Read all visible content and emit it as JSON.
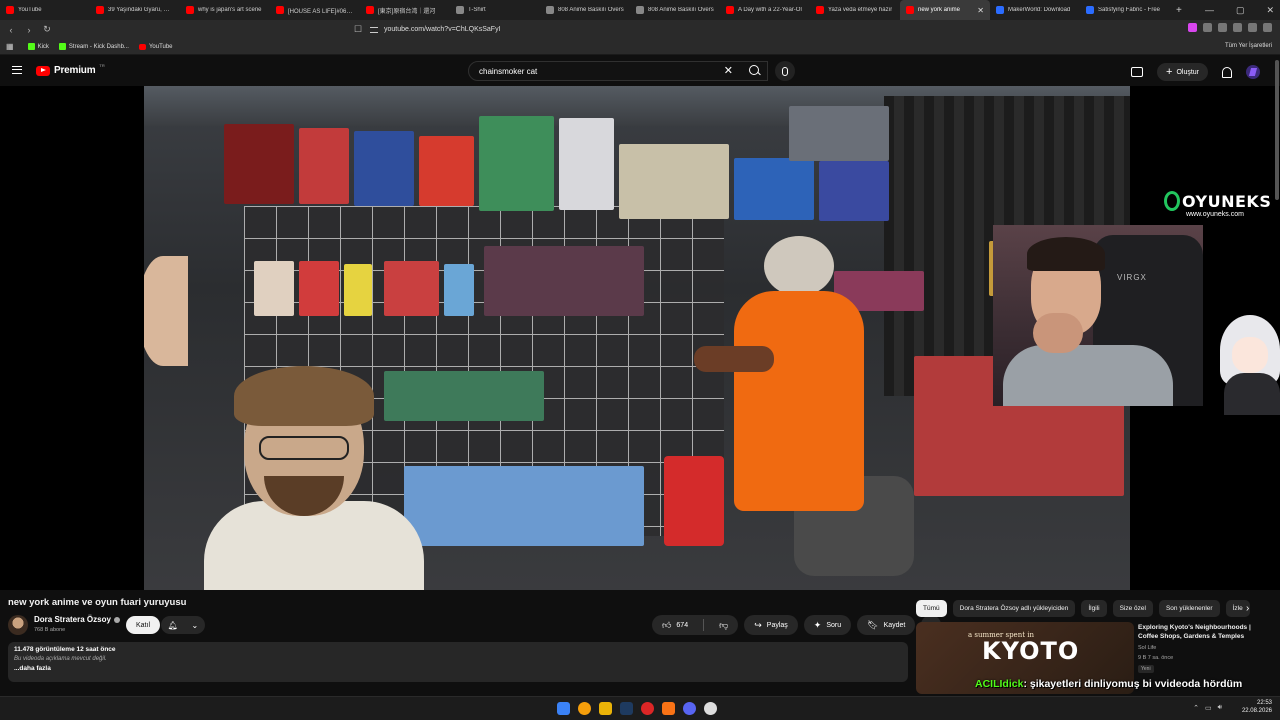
{
  "browser": {
    "tabs": [
      {
        "title": "YouTube",
        "icon": "youtube-icon",
        "active": false
      },
      {
        "title": "39 Yaşındaki Gyaru, Oun",
        "icon": "youtube-icon",
        "active": false
      },
      {
        "title": "why is japan's art scene",
        "icon": "youtube-icon",
        "active": false
      },
      {
        "title": "[HOUSE AS LIFE]#06 三",
        "icon": "youtube-icon",
        "active": false
      },
      {
        "title": "[東京]原宿台湾｜還河",
        "icon": "youtube-icon",
        "active": false
      },
      {
        "title": "T-Shirt",
        "icon": "page-icon",
        "active": false
      },
      {
        "title": "808 Anime Baskılı Overs",
        "icon": "page-icon",
        "active": false
      },
      {
        "title": "808 Anime Baskılı Overs",
        "icon": "page-icon",
        "active": false
      },
      {
        "title": "A Day with a 22-Year-Ol",
        "icon": "youtube-icon",
        "active": false
      },
      {
        "title": "Yaza veda etmeye hazır",
        "icon": "youtube-icon",
        "active": false
      },
      {
        "title": "new york anime",
        "icon": "youtube-icon",
        "active": true
      },
      {
        "title": "MakerWorld: Download",
        "icon": "makerworld-icon",
        "active": false
      },
      {
        "title": "Satisfying Fabric - Free",
        "icon": "makerworld-icon",
        "active": false
      }
    ],
    "new_tab": "+",
    "url": "youtube.com/watch?v=ChLQKsSaFyI",
    "bookmarks": [
      {
        "label": "Kick",
        "icon": "kick-icon"
      },
      {
        "label": "Stream - Kick Dashb...",
        "icon": "kick-icon"
      },
      {
        "label": "YouTube",
        "icon": "youtube-icon"
      }
    ],
    "all_bookmarks": "Tüm Yer İşaretleri"
  },
  "youtube": {
    "logo_text": "Premium",
    "logo_country": "TR",
    "search_value": "chainsmoker cat",
    "create_label": "Oluştur"
  },
  "video": {
    "overlay_brand": "OYUNEKS",
    "overlay_site": "www.oyuneks.com",
    "webcam_chair_brand": "VIRGX",
    "title": "new york anime ve oyun fuari yuruyusu",
    "channel_name": "Dora Stratera Özsoy",
    "subscribers": "768 B abone",
    "join_label": "Katıl",
    "likes": "674",
    "share_label": "Paylaş",
    "ask_label": "Soru",
    "save_label": "Kaydet",
    "description_meta": "11.478 görüntüleme  12 saat önce",
    "description_empty": "Bu videoda açıklama mevcut değil.",
    "more_label": "...daha fazla"
  },
  "sidebar": {
    "chips": [
      "Tümü",
      "Dora Stratera Özsoy adlı yükleyiciden",
      "İlgili",
      "Size özel",
      "Son yüklenenler",
      "İzle"
    ],
    "recommendation": {
      "thumb_small": "a summer spent in",
      "thumb_big": "KYOTO",
      "title": "Exploring Kyoto's Neighbourhoods | Coffee Shops, Gardens & Temples",
      "channel": "Sol Life",
      "stats": "9 B  7 sa. önce",
      "badge": "Yeni"
    }
  },
  "chat_overlay": {
    "user": "ACILIdick",
    "message": ": şikayetleri dinliyomuş bi vvideoda hördüm"
  },
  "taskbar": {
    "time": "22:53",
    "date": "22.08.2026"
  },
  "colors": {
    "youtube_red": "#ff0000",
    "kick_green": "#53fc18",
    "background": "#0f0f0f",
    "shirt_orange": "#f06a11"
  }
}
